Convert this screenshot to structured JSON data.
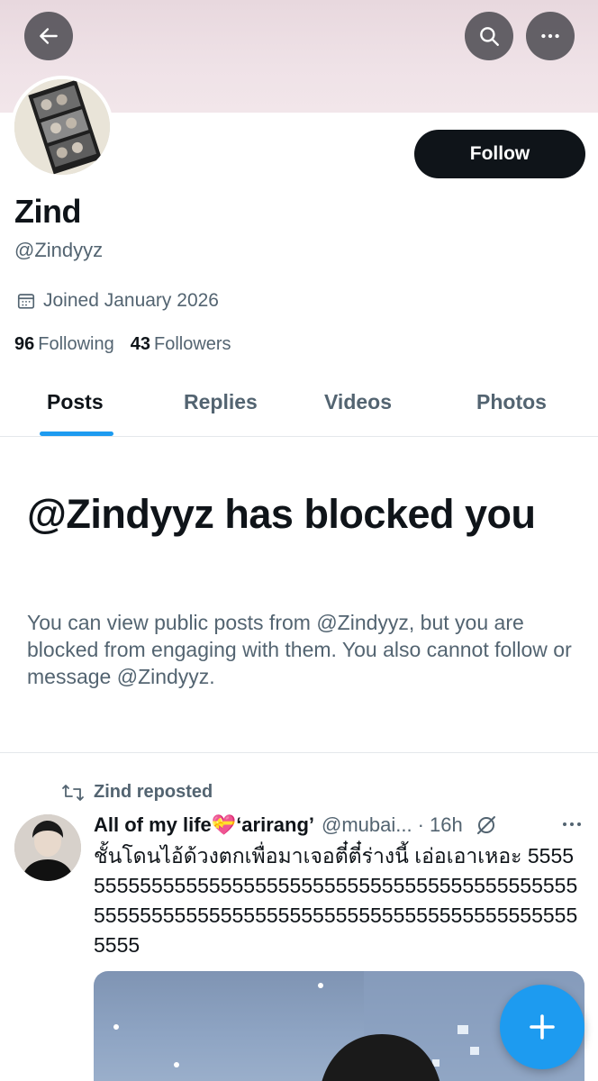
{
  "profile": {
    "name": "Zind",
    "handle": "@Zindyyz",
    "joined": "Joined January 2026",
    "following_count": "96",
    "following_label": "Following",
    "followers_count": "43",
    "followers_label": "Followers",
    "follow_label": "Follow"
  },
  "tabs": [
    {
      "label": "Posts",
      "active": true
    },
    {
      "label": "Replies",
      "active": false
    },
    {
      "label": "Videos",
      "active": false
    },
    {
      "label": "Photos",
      "active": false
    }
  ],
  "blocked": {
    "title": "@Zindyyz has blocked you",
    "description": "You can view public posts from @Zindyyz, but you are blocked from engaging with them. You also cannot follow or message @Zindyyz."
  },
  "post": {
    "repost_label": "Zind reposted",
    "author_name": "All of my life💝‘arirang’",
    "author_handle": "@mubai...",
    "time": "· 16h",
    "text": "ชั้นโดนไอ้ด้วงตกเพื่อมาเจอตี๋ตี๋ร่างนี้ เอ่อเอาเหอะ 55555555555555555555555555555555555555555555555555555555555555555555555555555555555555555555"
  },
  "icons": {
    "back": "arrow-left-icon",
    "search": "search-icon",
    "more": "more-horizontal-icon",
    "calendar": "calendar-icon",
    "repost": "repost-icon",
    "grok": "grok-icon",
    "compose": "plus-icon"
  },
  "colors": {
    "accent": "#1d9bf0",
    "primary_text": "#0f1419",
    "secondary_text": "#536471",
    "follow_button": "#0f1419"
  }
}
